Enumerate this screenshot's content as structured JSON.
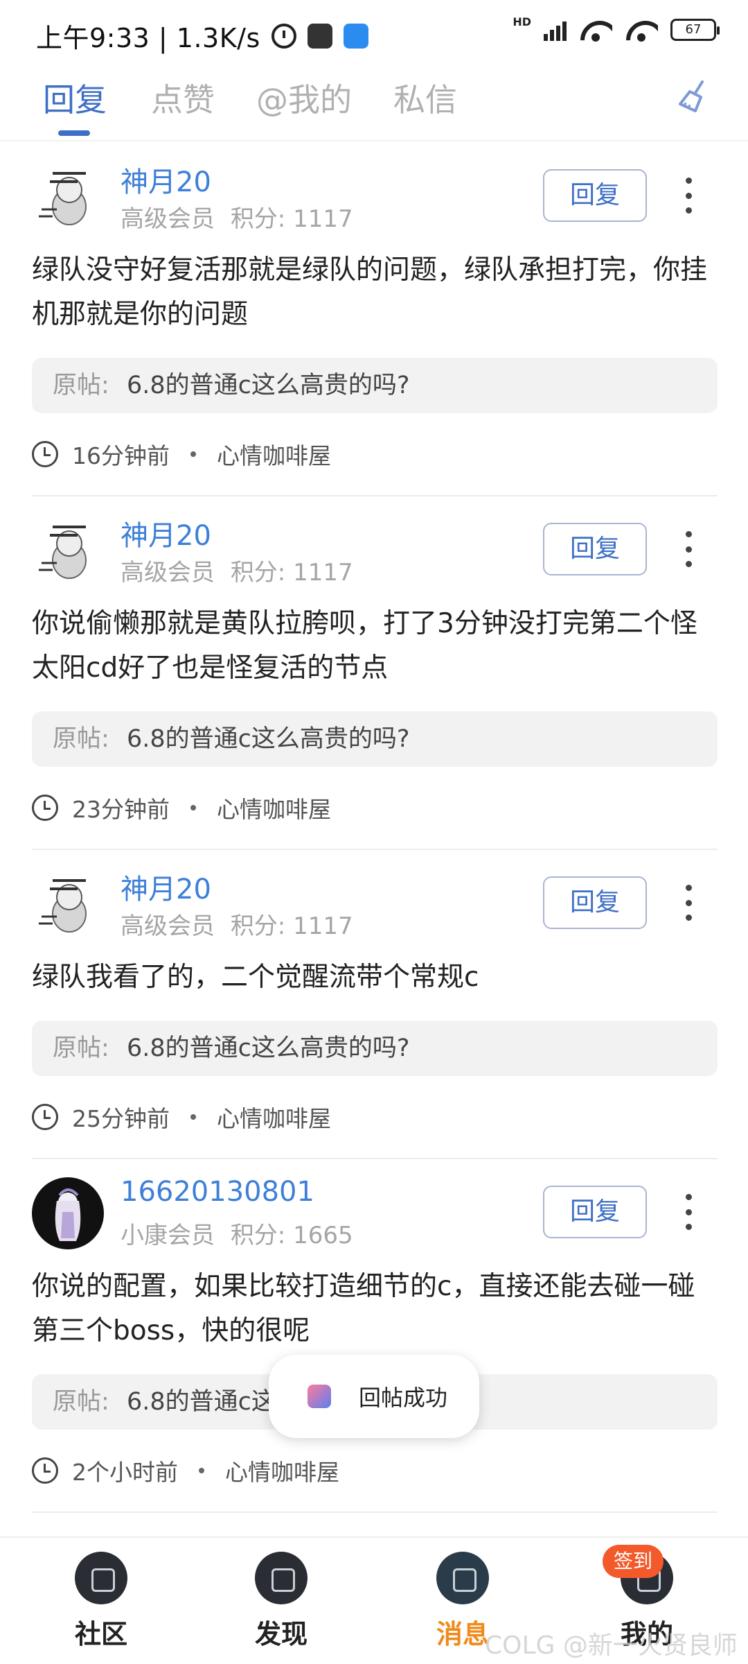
{
  "status_bar": {
    "time": "上午9:33 | 1.3K/s",
    "hd": "HD",
    "battery": "67"
  },
  "tabs": [
    {
      "label": "回复",
      "active": true
    },
    {
      "label": "点赞",
      "active": false
    },
    {
      "label": "@我的",
      "active": false
    },
    {
      "label": "私信",
      "active": false
    }
  ],
  "feed": [
    {
      "username": "神月20",
      "member_level": "高级会员",
      "score_text": "积分: 1117",
      "reply_label": "回复",
      "content": "绿队没守好复活那就是绿队的问题，绿队承担打完，你挂机那就是你的问题",
      "orig_label": "原帖:",
      "orig_title": "6.8的普通c这么高贵的吗?",
      "time_ago": "16分钟前",
      "forum": "心情咖啡屋"
    },
    {
      "username": "神月20",
      "member_level": "高级会员",
      "score_text": "积分: 1117",
      "reply_label": "回复",
      "content": "你说偷懒那就是黄队拉胯呗，打了3分钟没打完第二个怪太阳cd好了也是怪复活的节点",
      "orig_label": "原帖:",
      "orig_title": "6.8的普通c这么高贵的吗?",
      "time_ago": "23分钟前",
      "forum": "心情咖啡屋"
    },
    {
      "username": "神月20",
      "member_level": "高级会员",
      "score_text": "积分: 1117",
      "reply_label": "回复",
      "content": "绿队我看了的，二个觉醒流带个常规c",
      "orig_label": "原帖:",
      "orig_title": "6.8的普通c这么高贵的吗?",
      "time_ago": "25分钟前",
      "forum": "心情咖啡屋"
    },
    {
      "username": "16620130801",
      "member_level": "小康会员",
      "score_text": "积分: 1665",
      "reply_label": "回复",
      "content": "你说的配置，如果比较打造细节的c，直接还能去碰一碰第三个boss，快的很呢",
      "orig_label": "原帖:",
      "orig_title": "6.8的普通c这么高贵的吗?",
      "time_ago": "2个小时前",
      "forum": "心情咖啡屋"
    }
  ],
  "toast": {
    "text": "回帖成功"
  },
  "bottom_nav": {
    "items": [
      {
        "label": "社区",
        "active": false
      },
      {
        "label": "发现",
        "active": false
      },
      {
        "label": "消息",
        "active": true
      },
      {
        "label": "我的",
        "active": false
      }
    ],
    "signin_badge": "签到"
  },
  "watermark": "COLG @新一火贤良师",
  "colors": {
    "accent": "#3e6fc7",
    "username": "#3e7fd8",
    "active_nav": "#f08a1b",
    "badge": "#f35a2b"
  }
}
